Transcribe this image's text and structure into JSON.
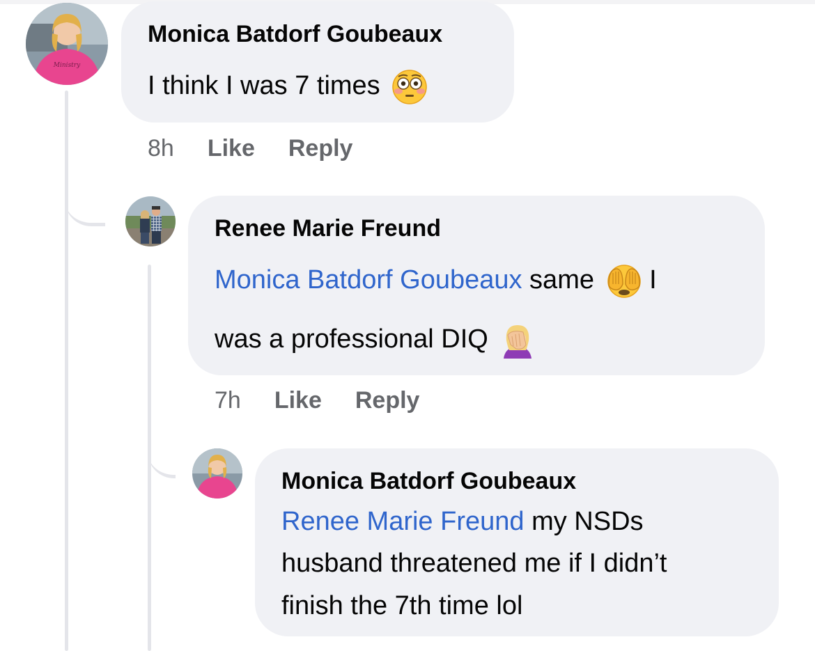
{
  "comments": [
    {
      "author": "Monica Batdorf Goubeaux",
      "text": "I think I was 7 times",
      "emoji": "flushed-face-icon",
      "time": "8h",
      "like": "Like",
      "reply": "Reply"
    },
    {
      "author": "Renee Marie Freund",
      "mention": "Monica Batdorf Goubeaux",
      "text_line1": " same",
      "emoji1": "see-no-evil-monkey-icon",
      "text_line1_tail": " I",
      "text_line2": "was a professional DIQ",
      "emoji2": "woman-facepalming-icon",
      "time": "7h",
      "like": "Like",
      "reply": "Reply"
    },
    {
      "author": "Monica Batdorf Goubeaux",
      "mention": "Renee Marie Freund",
      "text_line1": " my NSDs",
      "text_line2": "husband threatened me if I didn’t",
      "text_line3": "finish the 7th time lol"
    }
  ],
  "colors": {
    "bubble": "#f0f1f5",
    "mention": "#2f65cc",
    "meta": "#65676b",
    "thread_line": "#e4e5ea"
  }
}
